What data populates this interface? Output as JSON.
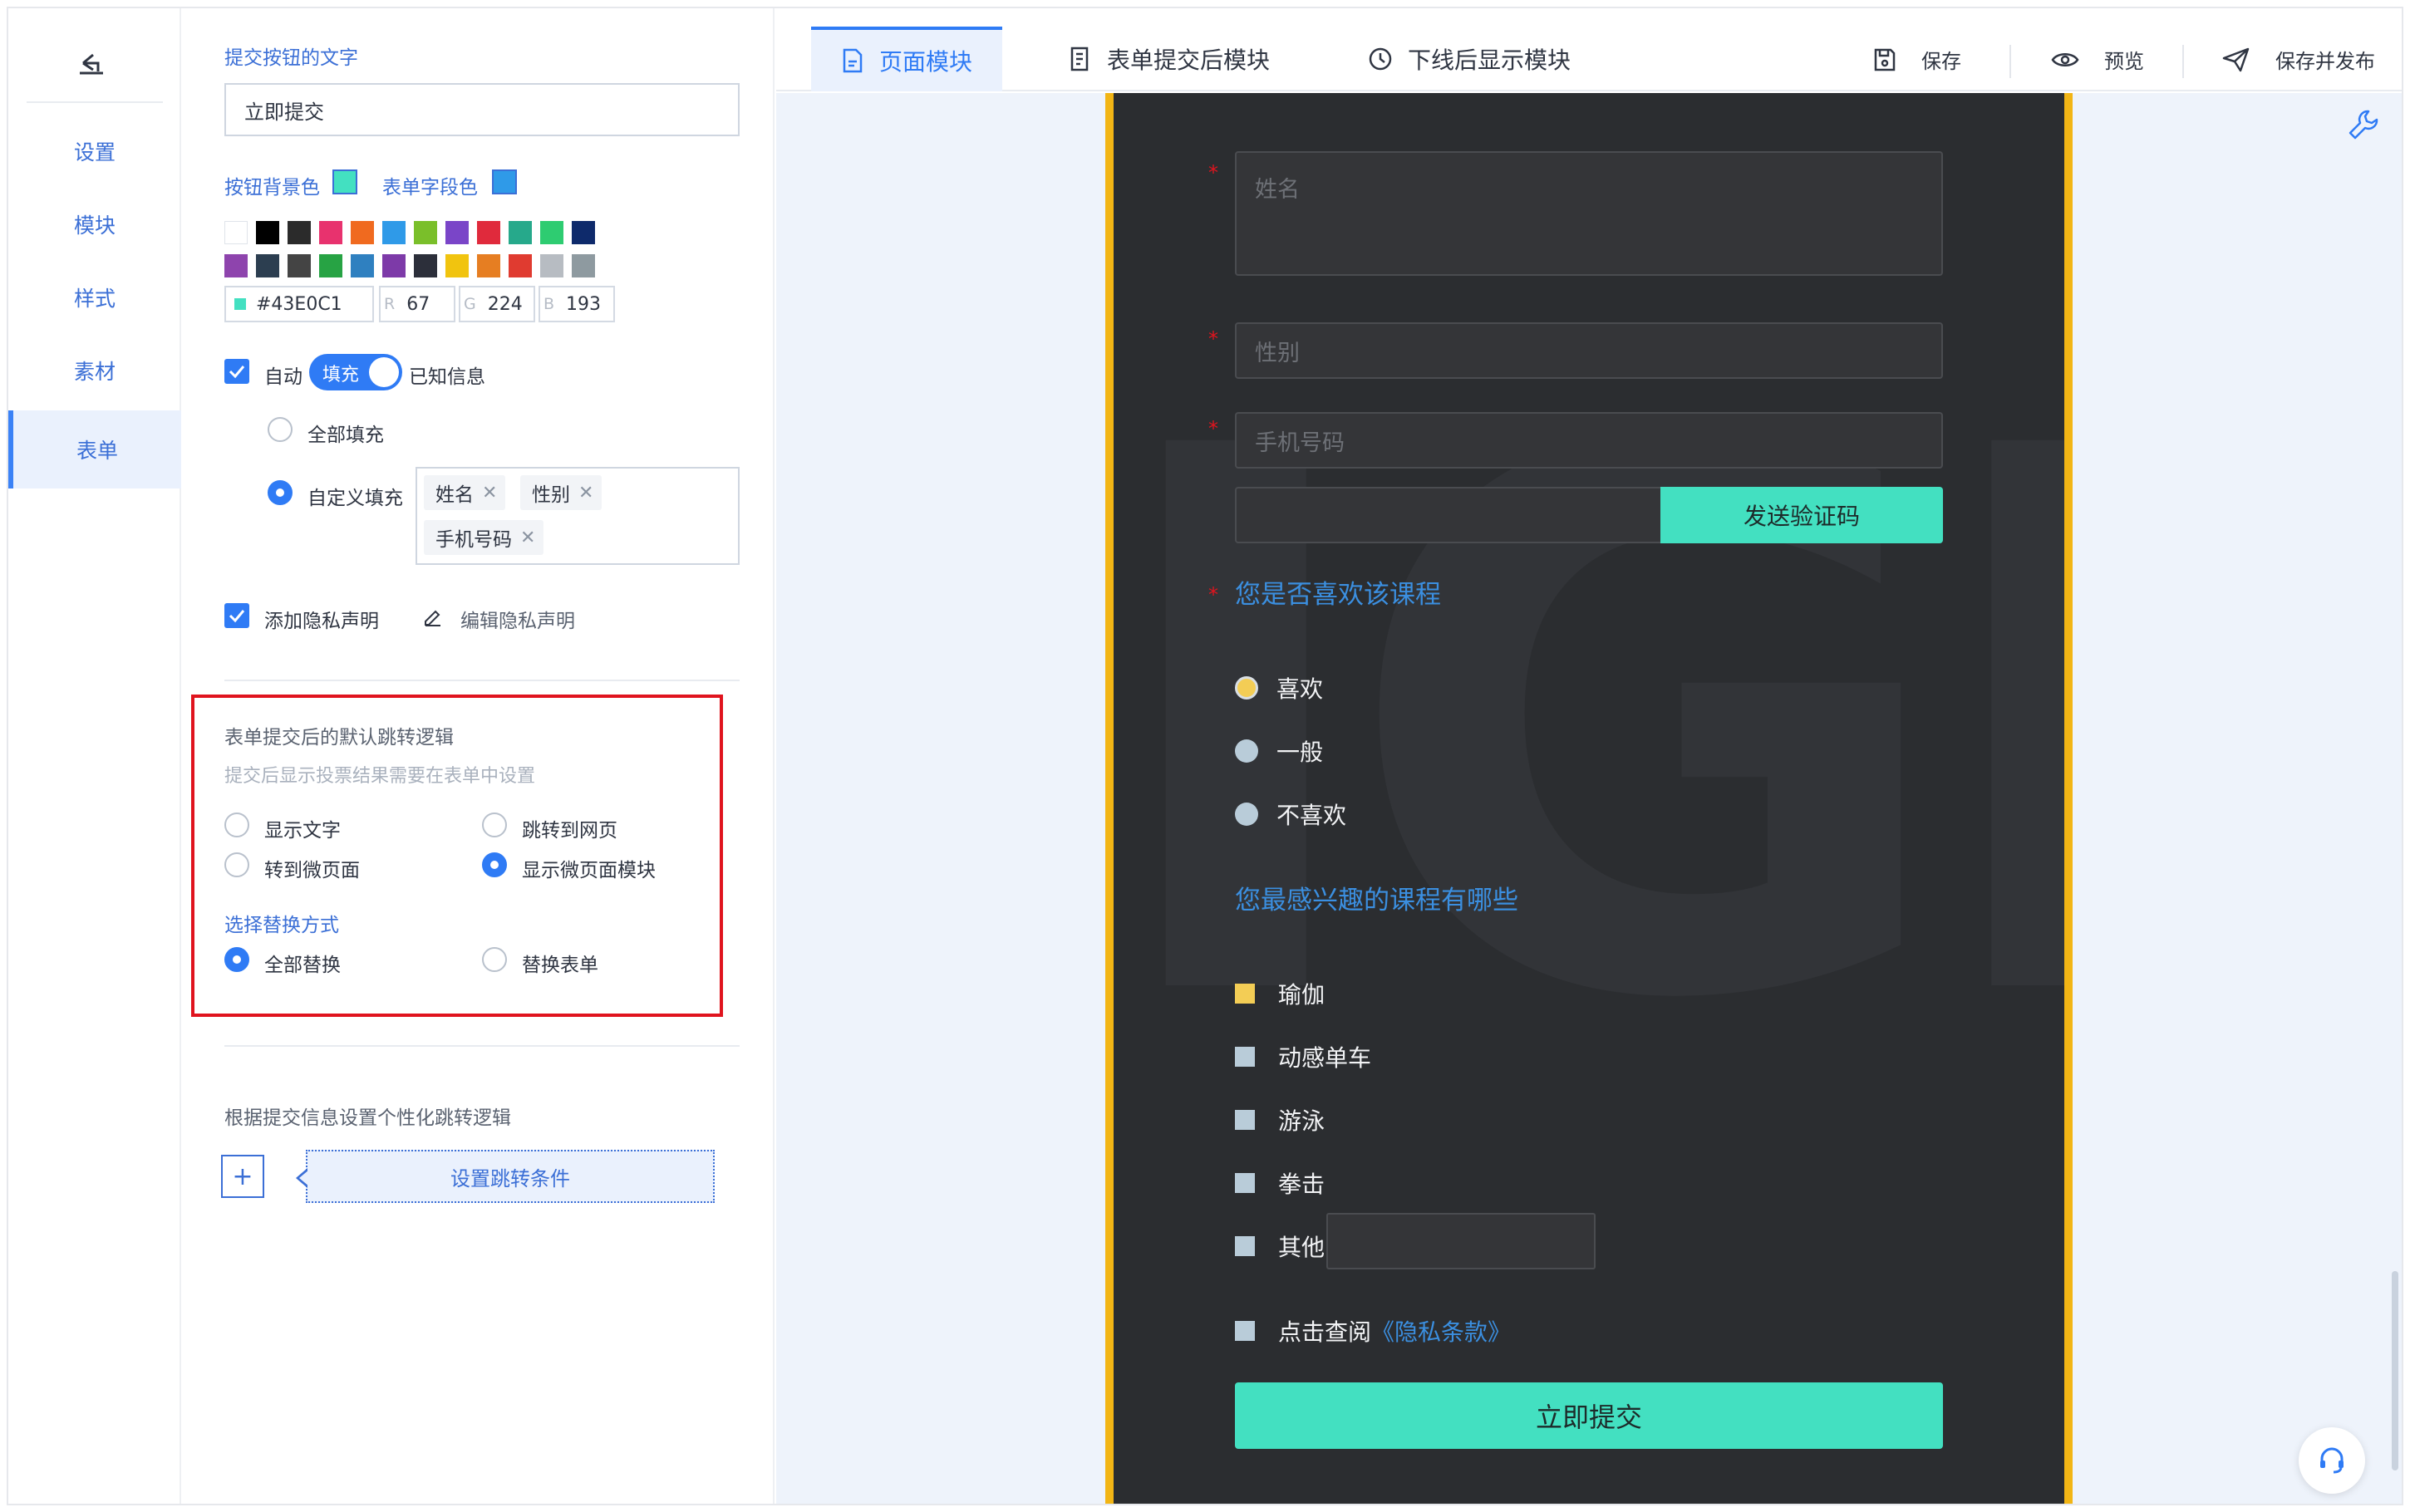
{
  "nav": {
    "items": [
      {
        "label": "设置"
      },
      {
        "label": "模块"
      },
      {
        "label": "样式"
      },
      {
        "label": "素材"
      },
      {
        "label": "表单"
      }
    ],
    "active": "表单"
  },
  "panel": {
    "submit_text_label": "提交按钮的文字",
    "submit_text_value": "立即提交",
    "button_bg_label": "按钮背景色",
    "button_bg_color": "#43E0C1",
    "field_color_label": "表单字段色",
    "field_color": "#2F9AE8",
    "palette_row1": [
      "#FFFFFF",
      "#000000",
      "#2B2B2B",
      "#E8326E",
      "#F06A1F",
      "#2F9AE8",
      "#7ABF2A",
      "#7A45C8",
      "#E02A3C",
      "#26A98B",
      "#2ECC71",
      "#0E2A6B"
    ],
    "palette_row2": [
      "#8E44AD",
      "#2C3E50",
      "#444444",
      "#27A344",
      "#2F80C0",
      "#7D3AA8",
      "#2C2F3A",
      "#F1C40F",
      "#E67E22",
      "#E03B30",
      "#B7BCC2",
      "#8E9AA0"
    ],
    "hex_value": "#43E0C1",
    "r_label": "R",
    "r_value": "67",
    "g_label": "G",
    "g_value": "224",
    "b_label": "B",
    "b_value": "193",
    "auto_label": "自动",
    "fill_toggle": "填充",
    "known_info": "已知信息",
    "fill_all": "全部填充",
    "fill_custom": "自定义填充",
    "fill_tags": [
      "姓名",
      "性别",
      "手机号码"
    ],
    "privacy_label": "添加隐私声明",
    "edit_privacy": "编辑隐私声明",
    "redirect_title": "表单提交后的默认跳转逻辑",
    "redirect_hint": "提交后显示投票结果需要在表单中设置",
    "redirect_options": [
      "显示文字",
      "跳转到网页",
      "转到微页面",
      "显示微页面模块"
    ],
    "redirect_selected": "显示微页面模块",
    "replace_title": "选择替换方式",
    "replace_options": [
      "全部替换",
      "替换表单"
    ],
    "replace_selected": "全部替换",
    "personal_title": "根据提交信息设置个性化跳转逻辑",
    "add_symbol": "+",
    "set_condition": "设置跳转条件"
  },
  "topbar": {
    "tabs": [
      {
        "label": "页面模块",
        "icon": "document-icon"
      },
      {
        "label": "表单提交后模块",
        "icon": "form-icon"
      },
      {
        "label": "下线后显示模块",
        "icon": "clock-icon"
      }
    ],
    "active_tab": "页面模块",
    "actions": [
      {
        "label": "保存",
        "icon": "save-icon"
      },
      {
        "label": "预览",
        "icon": "eye-icon"
      },
      {
        "label": "保存并发布",
        "icon": "send-icon"
      }
    ]
  },
  "form_preview": {
    "name_placeholder": "姓名",
    "gender_placeholder": "性别",
    "phone_placeholder": "手机号码",
    "required_mark": "*",
    "send_code": "发送验证码",
    "q1_title": "您是否喜欢该课程",
    "q1_options": [
      "喜欢",
      "一般",
      "不喜欢"
    ],
    "q1_selected": "喜欢",
    "q2_title": "您最感兴趣的课程有哪些",
    "q2_options": [
      "瑜伽",
      "动感单车",
      "游泳",
      "拳击",
      "其他"
    ],
    "q2_selected": [
      "瑜伽"
    ],
    "privacy_prefix": "点击查阅",
    "privacy_link": "《隐私条款》",
    "submit": "立即提交"
  },
  "colors": {
    "accent": "#2F7BF5",
    "nav_text": "#3B6FD6",
    "phone_frame": "#F2B515",
    "phone_bg": "#2B2D30",
    "teal": "#43E0C1",
    "highlight_box": "#E0141E"
  }
}
